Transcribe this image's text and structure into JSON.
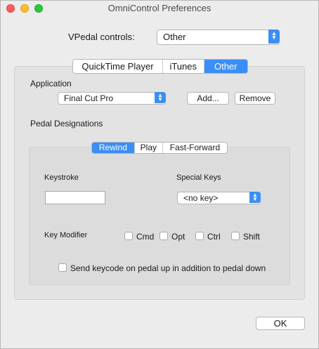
{
  "window": {
    "title": "OmniControl Preferences"
  },
  "vpedal": {
    "label": "VPedal controls:",
    "value": "Other"
  },
  "top_tabs": [
    "QuickTime Player",
    "iTunes",
    "Other"
  ],
  "application": {
    "label": "Application",
    "value": "Final Cut Pro",
    "add_label": "Add...",
    "remove_label": "Remove"
  },
  "pedal": {
    "label": "Pedal Designations",
    "tabs": [
      "Rewind",
      "Play",
      "Fast-Forward"
    ]
  },
  "keystroke": {
    "label": "Keystroke",
    "value": ""
  },
  "special_keys": {
    "label": "Special Keys",
    "value": "<no key>"
  },
  "modifiers": {
    "label": "Key Modifier",
    "items": [
      "Cmd",
      "Opt",
      "Ctrl",
      "Shift"
    ]
  },
  "send_keycode": {
    "label": "Send keycode on pedal up in addition to pedal down"
  },
  "ok_label": "OK",
  "colors": {
    "accent": "#3b8ef7"
  }
}
